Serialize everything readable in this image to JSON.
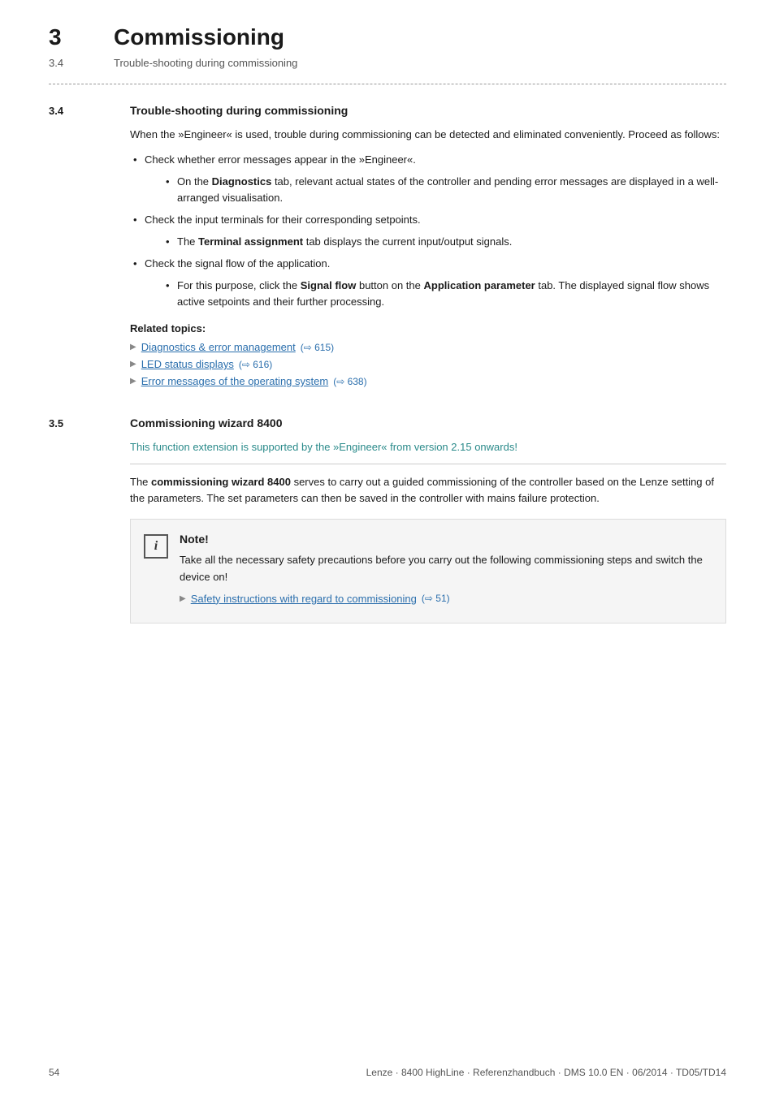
{
  "header": {
    "chapter_number": "3",
    "chapter_title": "Commissioning",
    "sub_number": "3.4",
    "sub_title": "Trouble-shooting during commissioning"
  },
  "section_34": {
    "number": "3.4",
    "heading": "Trouble-shooting during commissioning",
    "intro": "When the »Engineer« is used, trouble during commissioning can be detected and eliminated conveniently. Proceed as follows:",
    "bullets": [
      {
        "text": "Check whether error messages appear in the »Engineer«.",
        "sub": [
          {
            "text_before": "On the ",
            "bold": "Diagnostics",
            "text_after": " tab, relevant actual states of the controller and pending error messages are displayed in a well-arranged visualisation."
          }
        ]
      },
      {
        "text": "Check the input terminals for their corresponding setpoints.",
        "sub": [
          {
            "text_before": "The ",
            "bold": "Terminal assignment",
            "text_after": " tab displays the current input/output signals."
          }
        ]
      },
      {
        "text": "Check the signal flow of the application.",
        "sub": [
          {
            "text_before": "For this purpose, click the ",
            "bold1": "Signal flow",
            "text_middle": " button on the ",
            "bold2": "Application parameter",
            "text_after": " tab. The displayed signal flow shows active setpoints and their further processing."
          }
        ]
      }
    ],
    "related_topics_label": "Related topics:",
    "links": [
      {
        "text": "Diagnostics & error management",
        "ref": "(⇨ 615)"
      },
      {
        "text": "LED status displays",
        "ref": "(⇨ 616)"
      },
      {
        "text": "Error messages of the operating system",
        "ref": "(⇨ 638)"
      }
    ]
  },
  "section_35": {
    "number": "3.5",
    "heading": "Commissioning wizard 8400",
    "teal_notice": "This function extension is supported by the »Engineer« from version 2.15 onwards!",
    "para": "The commissioning wizard 8400 serves to carry out a guided commissioning of the controller based on the Lenze setting of the parameters. The set parameters can then be saved in the controller with mains failure protection.",
    "note_label": "Note!",
    "note_icon": "i",
    "note_text": "Take all the necessary safety precautions before you carry out the following commissioning steps and switch the device on!",
    "note_link_text": "Safety instructions with regard to commissioning",
    "note_link_ref": "(⇨ 51)"
  },
  "footer": {
    "page_number": "54",
    "publication": "Lenze · 8400 HighLine · Referenzhandbuch · DMS 10.0 EN · 06/2014 · TD05/TD14"
  }
}
